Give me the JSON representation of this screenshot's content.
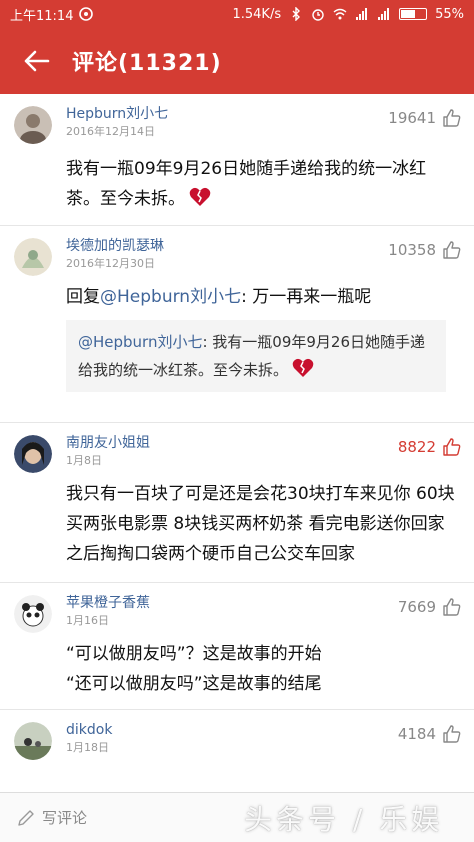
{
  "colors": {
    "brand": "#d43c33",
    "link": "#406599",
    "hot_like": "#d43c33"
  },
  "status_bar": {
    "time": "上午11:14",
    "speed": "1.54K/s",
    "battery": "55%"
  },
  "header": {
    "title": "评论(11321)",
    "back_icon": "arrow-left-icon"
  },
  "comments": [
    {
      "user": "Hepburn刘小七",
      "date": "2016年12月14日",
      "likes": "19641",
      "text": "我有一瓶09年9月26日她随手递给我的统一冰红茶。至今未拆。"
    },
    {
      "user": "埃德加的凯瑟琳",
      "date": "2016年12月30日",
      "likes": "10358",
      "reply_prefix": "回复",
      "reply_mention": "@Hepburn刘小七",
      "text": ": 万一再来一瓶呢",
      "quote_mention": "@Hepburn刘小七",
      "quote_text": ": 我有一瓶09年9月26日她随手递给我的统一冰红茶。至今未拆。"
    },
    {
      "user": "南朋友小姐姐",
      "date": "1月8日",
      "likes": "8822",
      "text": "我只有一百块了可是还是会花30块打车来见你 60块买两张电影票 8块钱买两杯奶茶 看完电影送你回家之后掏掏口袋两个硬币自己公交车回家"
    },
    {
      "user": "苹果橙子香蕉",
      "date": "1月16日",
      "likes": "7669",
      "text": "“可以做朋友吗”？这是故事的开始",
      "text2": "“还可以做朋友吗”这是故事的结尾"
    },
    {
      "user": "dikdok",
      "date": "1月18日",
      "likes": "4184",
      "text": ""
    }
  ],
  "bottom_bar": {
    "write_label": "写评论"
  },
  "watermark": "头条号 / 乐娱"
}
